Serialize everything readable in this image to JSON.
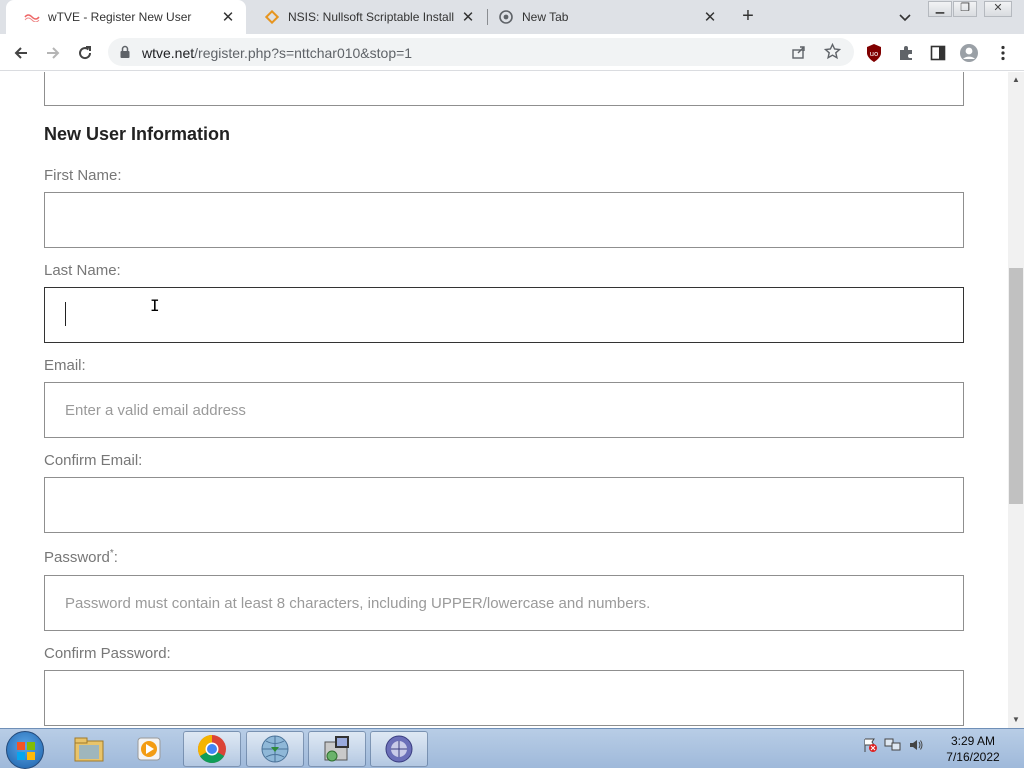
{
  "browser": {
    "tabs": [
      {
        "title": "wTVE - Register New User",
        "active": true
      },
      {
        "title": "NSIS: Nullsoft Scriptable Install Sy",
        "active": false
      },
      {
        "title": "New Tab",
        "active": false
      }
    ],
    "url_domain": "wtve.net",
    "url_path": "/register.php?s=nttchar010&stop=1"
  },
  "form": {
    "heading": "New User Information",
    "first_name_label": "First Name:",
    "first_name_value": "",
    "last_name_label": "Last Name:",
    "last_name_value": "",
    "email_label": "Email:",
    "email_placeholder": "Enter a valid email address",
    "confirm_email_label": "Confirm Email:",
    "password_label": "Password",
    "password_required_mark": "*",
    "password_label_suffix": ":",
    "password_placeholder": "Password must contain at least 8 characters, including UPPER/lowercase and numbers.",
    "confirm_password_label": "Confirm Password:"
  },
  "taskbar": {
    "time": "3:29 AM",
    "date": "7/16/2022"
  },
  "colors": {
    "tabbar_bg": "#dee1e6",
    "taskbar_bg": "#a9c1df",
    "ublock_red": "#800000"
  }
}
